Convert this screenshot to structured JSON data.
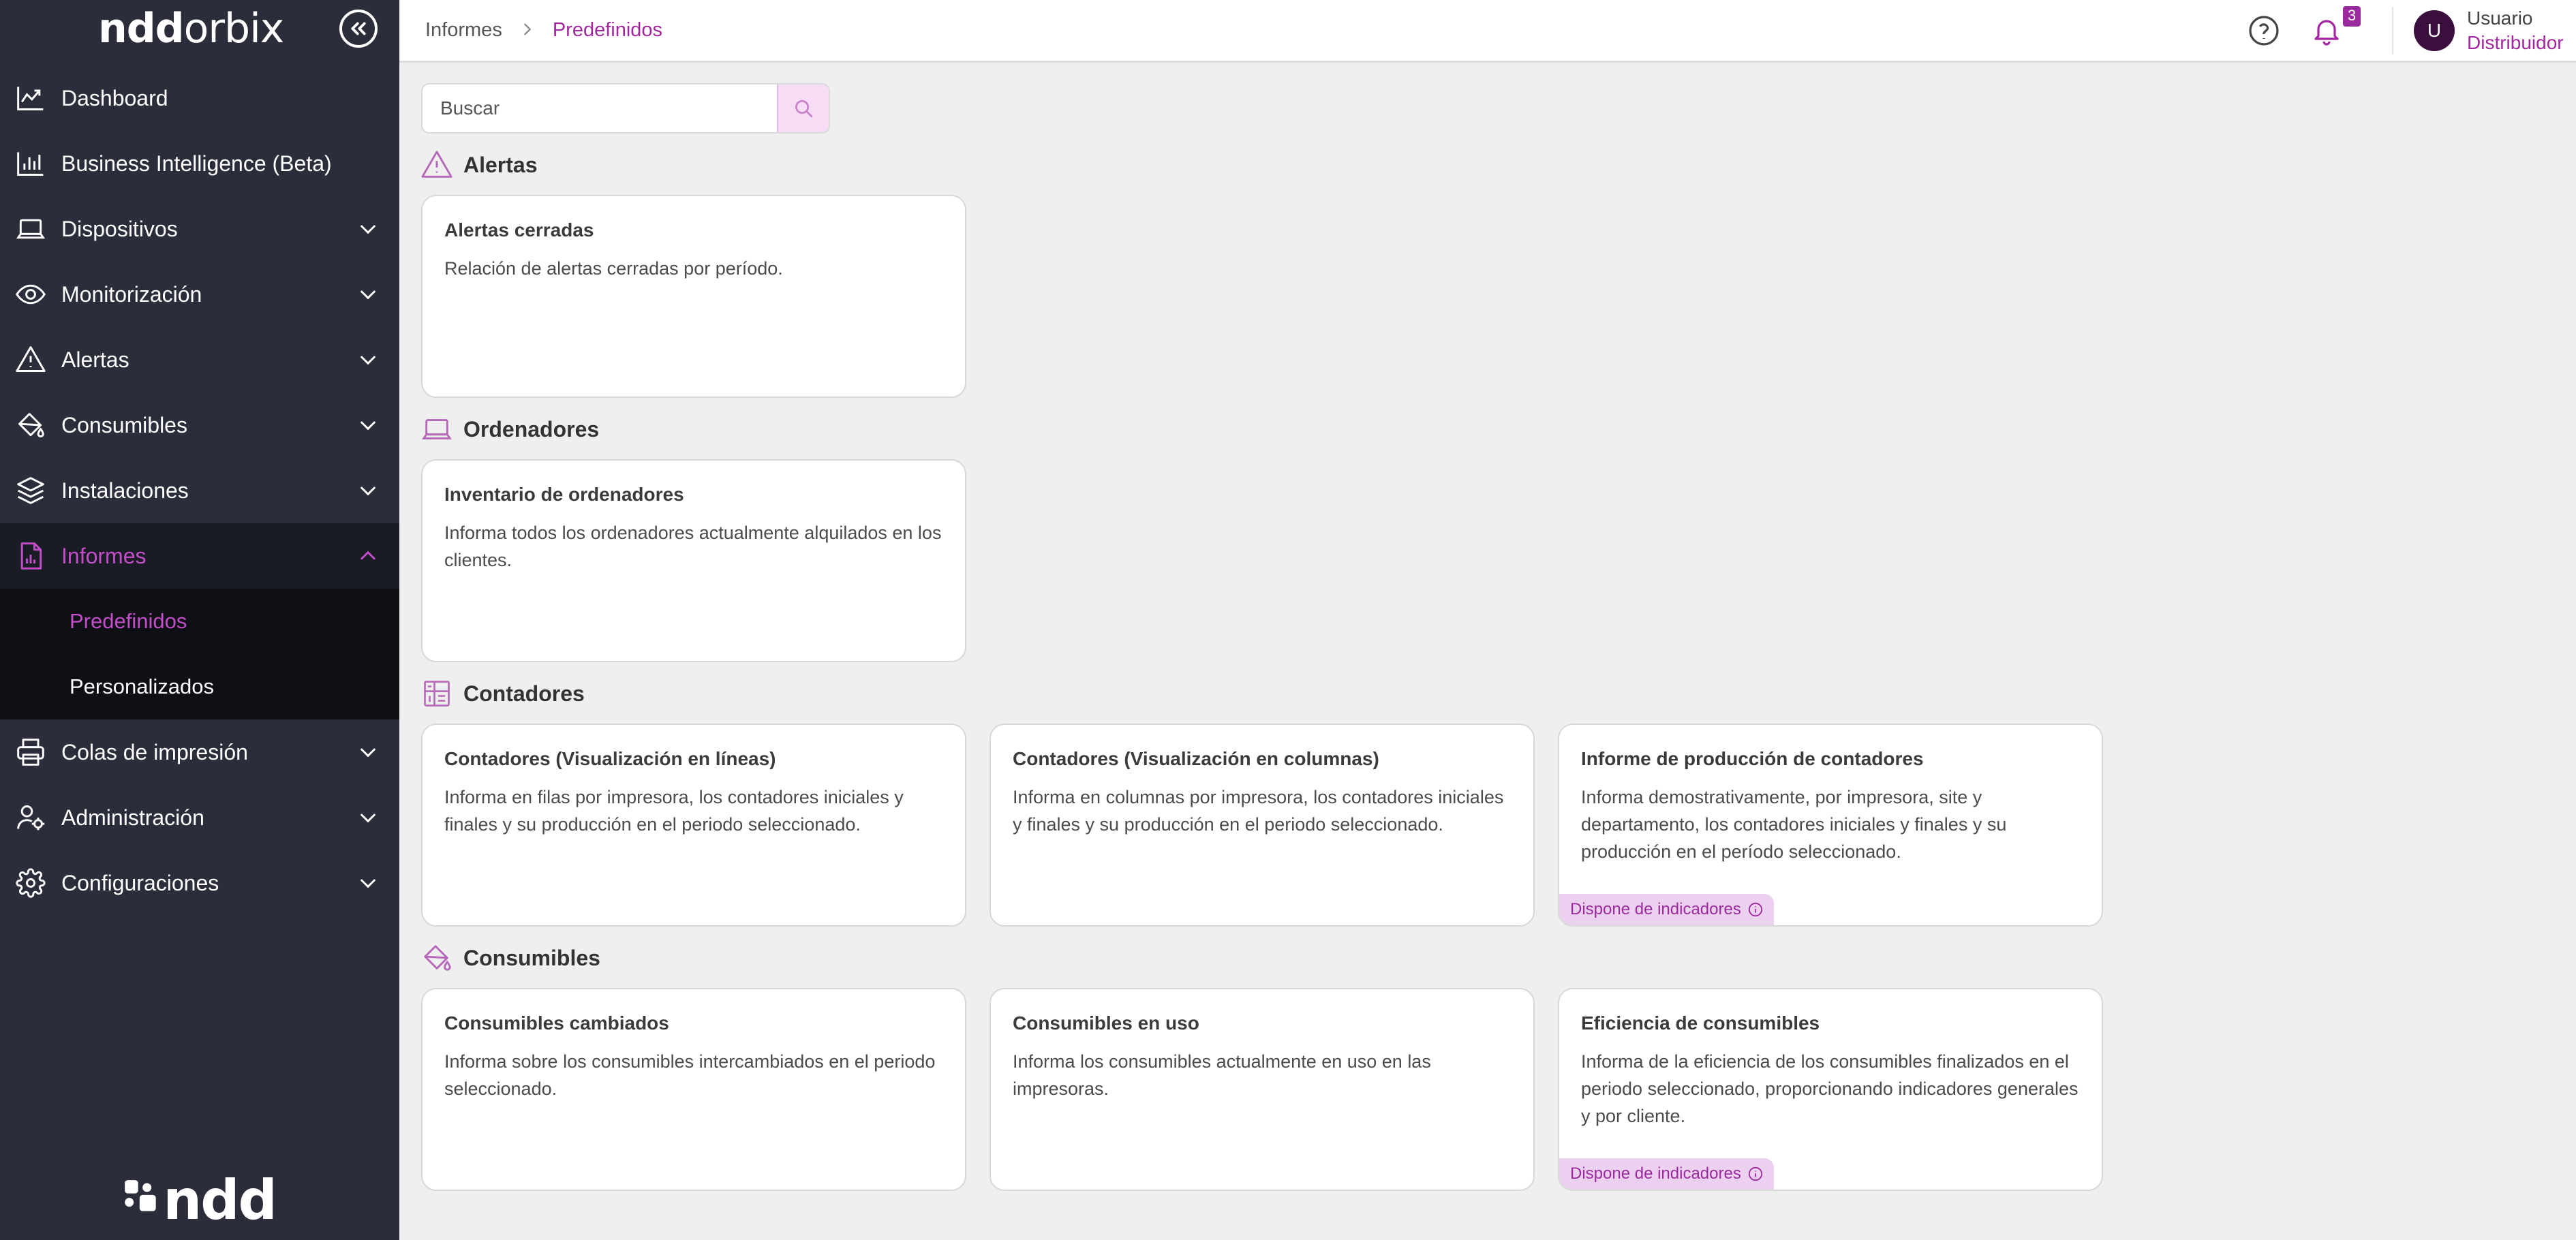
{
  "sidebar": {
    "logo": {
      "part1": "ndd",
      "part2": "orbix"
    },
    "items": [
      {
        "label": "Dashboard",
        "icon": "trend-chart-icon",
        "expandable": false
      },
      {
        "label": "Business Intelligence (Beta)",
        "icon": "bar-chart-icon",
        "expandable": false
      },
      {
        "label": "Dispositivos",
        "icon": "laptop-icon",
        "expandable": true
      },
      {
        "label": "Monitorización",
        "icon": "eye-icon",
        "expandable": true
      },
      {
        "label": "Alertas",
        "icon": "warning-icon",
        "expandable": true
      },
      {
        "label": "Consumibles",
        "icon": "paint-bucket-icon",
        "expandable": true
      },
      {
        "label": "Instalaciones",
        "icon": "layers-icon",
        "expandable": true
      },
      {
        "label": "Informes",
        "icon": "report-icon",
        "expandable": true,
        "active": true
      },
      {
        "label": "Colas de impresión",
        "icon": "printer-icon",
        "expandable": true
      },
      {
        "label": "Administración",
        "icon": "users-gear-icon",
        "expandable": true
      },
      {
        "label": "Configuraciones",
        "icon": "gear-icon",
        "expandable": true
      }
    ],
    "submenu": [
      {
        "label": "Predefinidos",
        "active": true
      },
      {
        "label": "Personalizados",
        "active": false
      }
    ],
    "footer_logo": "ndd"
  },
  "topbar": {
    "breadcrumb": [
      "Informes",
      "Predefinidos"
    ],
    "notifications_count": "3",
    "avatar_letter": "U",
    "user_name": "Usuario",
    "user_role": "Distribuidor"
  },
  "search": {
    "placeholder": "Buscar",
    "value": ""
  },
  "sections": [
    {
      "title": "Alertas",
      "icon": "warning-icon",
      "cards": [
        {
          "title": "Alertas cerradas",
          "desc": "Relación de alertas cerradas por período."
        }
      ]
    },
    {
      "title": "Ordenadores",
      "icon": "laptop-icon",
      "cards": [
        {
          "title": "Inventario de ordenadores",
          "desc": "Informa todos los ordenadores actualmente alquilados en los clientes."
        }
      ]
    },
    {
      "title": "Contadores",
      "icon": "counter-grid-icon",
      "cards": [
        {
          "title": "Contadores (Visualización en líneas)",
          "desc": "Informa en filas por impresora, los contadores iniciales y finales y su producción en el periodo seleccionado."
        },
        {
          "title": "Contadores (Visualización en columnas)",
          "desc": "Informa en columnas por impresora, los contadores iniciales y finales y su producción en el periodo seleccionado."
        },
        {
          "title": "Informe de producción de contadores",
          "desc": "Informa demostrativamente, por impresora, site y departamento, los contadores iniciales y finales y su producción en el período seleccionado.",
          "badge": "Dispone de indicadores"
        }
      ]
    },
    {
      "title": "Consumibles",
      "icon": "paint-bucket-icon",
      "cards": [
        {
          "title": "Consumibles cambiados",
          "desc": "Informa sobre los consumibles intercambiados en el periodo seleccionado."
        },
        {
          "title": "Consumibles en uso",
          "desc": "Informa los consumibles actualmente en uso en las impresoras."
        },
        {
          "title": "Eficiencia de consumibles",
          "desc": "Informa de la eficiencia de los consumibles finalizados en el periodo seleccionado, proporcionando indicadores generales y por cliente.",
          "badge": "Dispone de indicadores"
        }
      ]
    }
  ],
  "colors": {
    "sidebar_bg": "#2b2d3a",
    "accent": "#a2279f",
    "badge_bg": "#ecd0ef"
  }
}
